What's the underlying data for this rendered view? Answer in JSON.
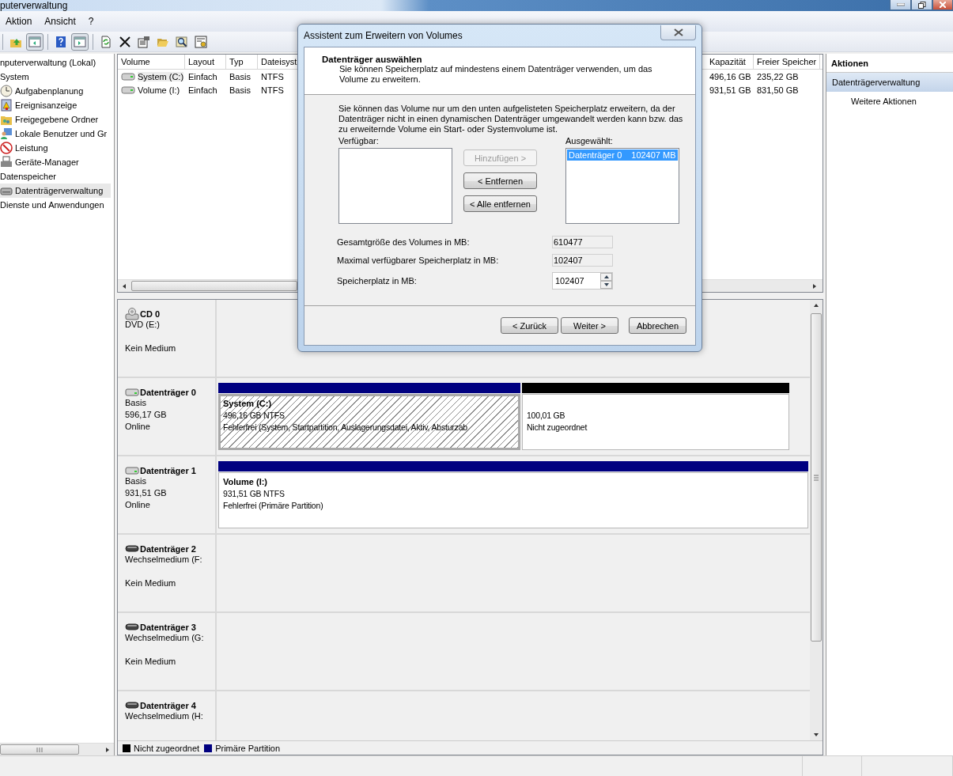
{
  "window": {
    "title": "puterverwaltung"
  },
  "menu": [
    {
      "label": "Aktion"
    },
    {
      "label": "Ansicht"
    },
    {
      "label": "?"
    }
  ],
  "toolbar": [
    {
      "kind": "separator"
    },
    {
      "kind": "up-folder",
      "pressed": false
    },
    {
      "kind": "tree-pane",
      "pressed": true
    },
    {
      "kind": "separator"
    },
    {
      "kind": "help",
      "pressed": false
    },
    {
      "kind": "action-pane",
      "pressed": true
    },
    {
      "kind": "separator"
    },
    {
      "kind": "refresh",
      "pressed": false
    },
    {
      "kind": "delete",
      "pressed": false
    },
    {
      "kind": "properties",
      "pressed": false
    },
    {
      "kind": "open",
      "pressed": false
    },
    {
      "kind": "search",
      "pressed": false
    },
    {
      "kind": "settings",
      "pressed": false
    }
  ],
  "tree": [
    {
      "label": "nputerverwaltung (Lokal)",
      "selected": false,
      "children": [
        {
          "label": "System",
          "selected": false,
          "children": [
            {
              "label": "Aufgabenplanung",
              "kind": "clock",
              "selected": false
            },
            {
              "label": "Ereignisanzeige",
              "kind": "event",
              "selected": false
            },
            {
              "label": "Freigegebene Ordner",
              "kind": "folder",
              "selected": false
            },
            {
              "label": "Lokale Benutzer und Gr",
              "kind": "users",
              "selected": false
            },
            {
              "label": "Leistung",
              "kind": "gauge",
              "selected": false
            },
            {
              "label": "Geräte-Manager",
              "kind": "device",
              "selected": false
            }
          ]
        },
        {
          "label": "Datenspeicher",
          "selected": false,
          "children": [
            {
              "label": "Datenträgerverwaltung",
              "kind": "disk",
              "selected": true
            }
          ]
        },
        {
          "label": "Dienste und Anwendungen",
          "selected": false
        }
      ]
    }
  ],
  "volumes": {
    "columns": [
      "Volume",
      "Layout",
      "Typ",
      "Dateisyst",
      "Kapazität",
      "Freier Speicher"
    ],
    "rows": [
      {
        "selected": true,
        "cells": [
          "System (C:)",
          "Einfach",
          "Basis",
          "NTFS",
          "496,16 GB",
          "235,22 GB"
        ]
      },
      {
        "selected": false,
        "cells": [
          "Volume (I:)",
          "Einfach",
          "Basis",
          "NTFS",
          "931,51 GB",
          "831,50 GB"
        ]
      }
    ]
  },
  "disks": [
    {
      "kind": "cd",
      "name": "CD 0",
      "subtitle": "DVD (E:)",
      "status": "Kein Medium"
    },
    {
      "kind": "basic",
      "name": "Datenträger 0",
      "subtitle": "Basis",
      "size": "596,17 GB",
      "status": "Online",
      "partitions": [
        {
          "kind": "primary",
          "selected": true,
          "name": "System  (C:)",
          "size": "496,16 GB NTFS",
          "status": "Fehlerfrei (System, Startpartition, Auslagerungsdatei, Aktiv, Absturzab"
        },
        {
          "kind": "unallocated",
          "selected": false,
          "size": "100,01 GB",
          "status": "Nicht zugeordnet"
        }
      ]
    },
    {
      "kind": "basic",
      "name": "Datenträger 1",
      "subtitle": "Basis",
      "size": "931,51 GB",
      "status": "Online",
      "partitions": [
        {
          "kind": "primary",
          "selected": false,
          "name": "Volume  (I:)",
          "size": "931,51 GB NTFS",
          "status": "Fehlerfrei (Primäre Partition)"
        }
      ]
    },
    {
      "kind": "removable",
      "name": "Datenträger 2",
      "subtitle": "Wechselmedium (F:",
      "status": "Kein Medium"
    },
    {
      "kind": "removable",
      "name": "Datenträger 3",
      "subtitle": "Wechselmedium (G:",
      "status": "Kein Medium"
    },
    {
      "kind": "removable",
      "name": "Datenträger 4",
      "subtitle": "Wechselmedium (H:"
    }
  ],
  "legend": [
    {
      "label": "Nicht zugeordnet",
      "color": "#000000"
    },
    {
      "label": "Primäre Partition",
      "color": "#000080"
    }
  ],
  "actions": {
    "title": "Aktionen",
    "items": [
      {
        "kind": "section",
        "label": "Datenträgerverwaltung"
      },
      {
        "kind": "link",
        "label": "Weitere Aktionen"
      }
    ]
  },
  "dialog": {
    "title": "Assistent zum Erweitern von Volumes",
    "heading": "Datenträger auswählen",
    "subheading": "Sie können Speicherplatz auf mindestens einem Datenträger verwenden, um das Volume zu erweitern.",
    "info": "Sie können das Volume nur um den unten aufgelisteten Speicherplatz erweitern, da der Datenträger nicht in einen dynamischen Datenträger umgewandelt werden kann bzw. das zu erweiternde Volume ein Start- oder Systemvolume ist.",
    "available_label": "Verfügbar:",
    "selected_label": "Ausgewählt:",
    "selected_items": [
      {
        "name": "Datenträger 0",
        "size": "102407 MB",
        "selected": true
      }
    ],
    "move_buttons": [
      {
        "label": "Hinzufügen >",
        "disabled": true
      },
      {
        "label": "< Entfernen",
        "disabled": false
      },
      {
        "label": "< Alle entfernen",
        "disabled": false
      }
    ],
    "fields": [
      {
        "kind": "readonly",
        "label": "Gesamtgröße des Volumes in MB:",
        "value": "610477"
      },
      {
        "kind": "readonly",
        "label": "Maximal verfügbarer Speicherplatz in MB:",
        "value": "102407"
      },
      {
        "kind": "spin",
        "label": "Speicherplatz in MB:",
        "value": "102407"
      }
    ],
    "buttons": [
      {
        "label": "< Zurück"
      },
      {
        "label": "Weiter >"
      },
      {
        "label": "Abbrechen"
      }
    ]
  }
}
